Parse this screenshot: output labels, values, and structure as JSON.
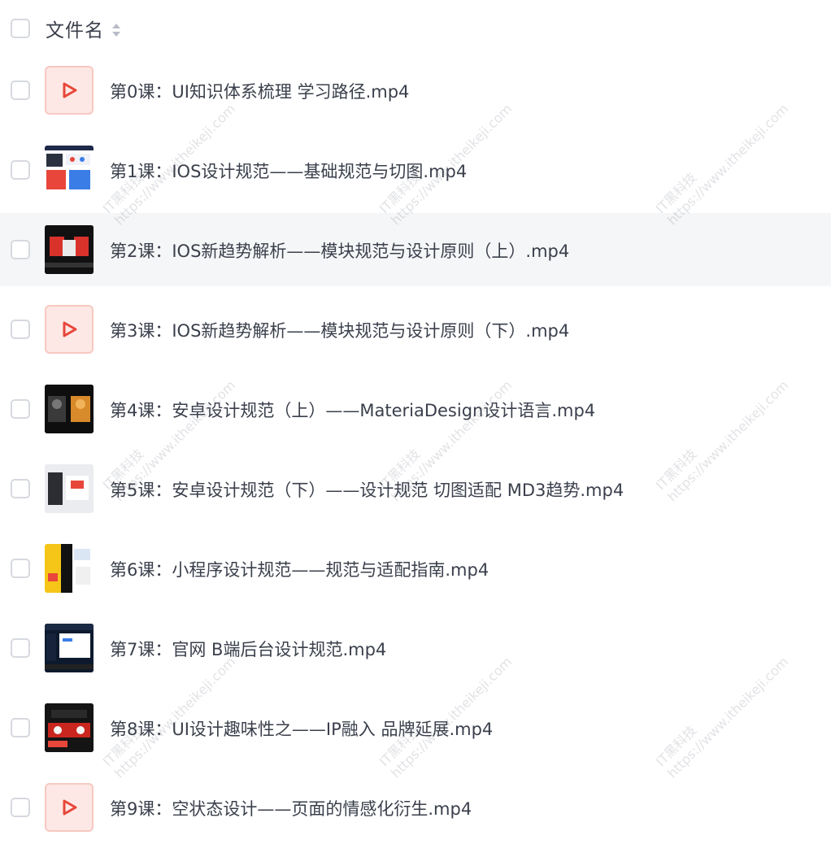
{
  "header": {
    "column_label": "文件名"
  },
  "files": [
    {
      "name": "第0课：UI知识体系梳理 学习路径.mp4",
      "thumb": "video-icon"
    },
    {
      "name": "第1课：IOS设计规范——基础规范与切图.mp4",
      "thumb": "preview"
    },
    {
      "name": "第2课：IOS新趋势解析——模块规范与设计原则（上）.mp4",
      "thumb": "preview"
    },
    {
      "name": "第3课：IOS新趋势解析——模块规范与设计原则（下）.mp4",
      "thumb": "video-icon"
    },
    {
      "name": "第4课：安卓设计规范（上）——MateriaDesign设计语言.mp4",
      "thumb": "preview"
    },
    {
      "name": "第5课：安卓设计规范（下）——设计规范 切图适配 MD3趋势.mp4",
      "thumb": "preview"
    },
    {
      "name": "第6课：小程序设计规范——规范与适配指南.mp4",
      "thumb": "preview"
    },
    {
      "name": "第7课：官网 B端后台设计规范.mp4",
      "thumb": "preview"
    },
    {
      "name": "第8课：UI设计趣味性之——IP融入 品牌延展.mp4",
      "thumb": "preview"
    },
    {
      "name": "第9课：空状态设计——页面的情感化衍生.mp4",
      "thumb": "video-icon"
    }
  ],
  "watermark": {
    "line1": "IT黑科技",
    "line2": "https://www.itheikeji.com"
  },
  "colors": {
    "accent": "#e8463a",
    "row_highlight": "#f5f6f7"
  }
}
